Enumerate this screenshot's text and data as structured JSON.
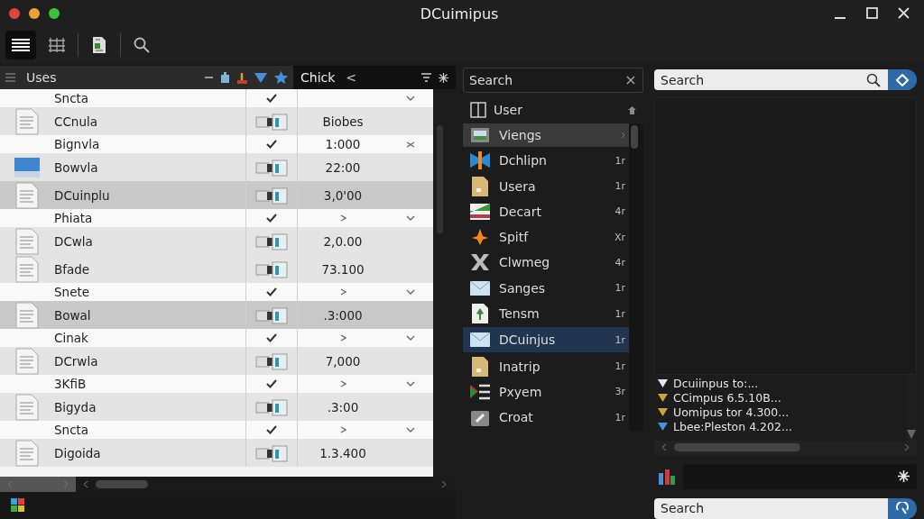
{
  "window": {
    "title": "DCuimipus"
  },
  "toolbar": [
    {
      "kind": "menu",
      "selected": true
    },
    {
      "kind": "grid",
      "selected": false
    },
    {
      "kind": "document",
      "selected": false
    },
    {
      "kind": "search",
      "selected": false
    }
  ],
  "left_panel": {
    "title": "Uses",
    "tab": "Chick",
    "back": "<",
    "rows": [
      {
        "kind": "detail",
        "name": "Sncta",
        "checked": true,
        "expand": true,
        "selected": false
      },
      {
        "kind": "file",
        "name": "CCnula",
        "value": "Biobes",
        "selected": false
      },
      {
        "kind": "detail",
        "name": "Bignvla",
        "checked": true,
        "value": "1:000",
        "expand": false,
        "selected": false
      },
      {
        "kind": "folder",
        "name": "Bowvla",
        "value": "22:00",
        "selected": false
      },
      {
        "kind": "file",
        "name": "DCuinplu",
        "value": "3,0'00",
        "selected": true
      },
      {
        "kind": "detail",
        "name": "Phiata",
        "checked": true,
        "arrow": true,
        "expand": true,
        "selected": false
      },
      {
        "kind": "file",
        "name": "DCwla",
        "value": "2,0.00",
        "selected": false
      },
      {
        "kind": "file",
        "name": "Bfade",
        "value": "73.100",
        "selected": false
      },
      {
        "kind": "detail",
        "name": "Snete",
        "checked": true,
        "arrow": true,
        "expand": true,
        "selected": false
      },
      {
        "kind": "file",
        "name": "Bowal",
        "value": ".3:000",
        "selected": true
      },
      {
        "kind": "detail",
        "name": "Cinak",
        "checked": true,
        "arrow": true,
        "expand": true,
        "selected": false
      },
      {
        "kind": "file",
        "name": "DCrwla",
        "value": "7,000",
        "selected": false
      },
      {
        "kind": "detail",
        "name": "3KfiB",
        "checked": true,
        "arrow": true,
        "expand": true,
        "selected": false
      },
      {
        "kind": "file",
        "name": "Bigyda",
        "value": ".3:00",
        "selected": false
      },
      {
        "kind": "detail",
        "name": "Sncta",
        "checked": true,
        "arrow": true,
        "expand": true,
        "selected": false
      },
      {
        "kind": "file",
        "name": "Digoida",
        "value": "1.3.400",
        "selected": false
      }
    ]
  },
  "middle_panel": {
    "search": {
      "placeholder": "Search"
    },
    "header": "User",
    "items": [
      {
        "kind": "image",
        "name": "Viengs",
        "hovered": true,
        "selected": false
      },
      {
        "kind": "app",
        "name": "Dchlipn",
        "count": "1r",
        "hovered": false,
        "selected": false
      },
      {
        "kind": "file",
        "name": "Usera",
        "count": "1r",
        "hovered": false,
        "selected": false
      },
      {
        "kind": "chart",
        "name": "Decart",
        "count": "4r",
        "hovered": false,
        "selected": false
      },
      {
        "kind": "star",
        "name": "Spitf",
        "count": "Xr",
        "hovered": false,
        "selected": false
      },
      {
        "kind": "cross",
        "name": "Clwmeg",
        "count": "4r",
        "hovered": false,
        "selected": false
      },
      {
        "kind": "mail",
        "name": "Sanges",
        "count": "1r",
        "hovered": false,
        "selected": false
      },
      {
        "kind": "doc",
        "name": "Tensm",
        "count": "1r",
        "hovered": false,
        "selected": false
      },
      {
        "kind": "mail",
        "name": "DCuinjus",
        "count": "1r",
        "hovered": false,
        "selected": true
      },
      {
        "kind": "file",
        "name": "Inatrip",
        "count": "1r",
        "hovered": false,
        "selected": false
      },
      {
        "kind": "flag",
        "name": "Pxyem",
        "count": "3r",
        "hovered": false,
        "selected": false
      },
      {
        "kind": "tool",
        "name": "Croat",
        "count": "1r",
        "hovered": false,
        "selected": false
      }
    ]
  },
  "right_panel": {
    "search": {
      "placeholder": "Search"
    },
    "log": [
      {
        "text": "Dcuiinpus to:...",
        "color": "#dce8f5"
      },
      {
        "text": "CCimpus 6.5.10B...",
        "color": "#c9a640"
      },
      {
        "text": "Uomipus tor 4.300...",
        "color": "#c9a640"
      },
      {
        "text": "Lbee:Pleston 4.202...",
        "color": "#4a90d9"
      }
    ],
    "bottom_search": {
      "placeholder": "Search"
    }
  }
}
